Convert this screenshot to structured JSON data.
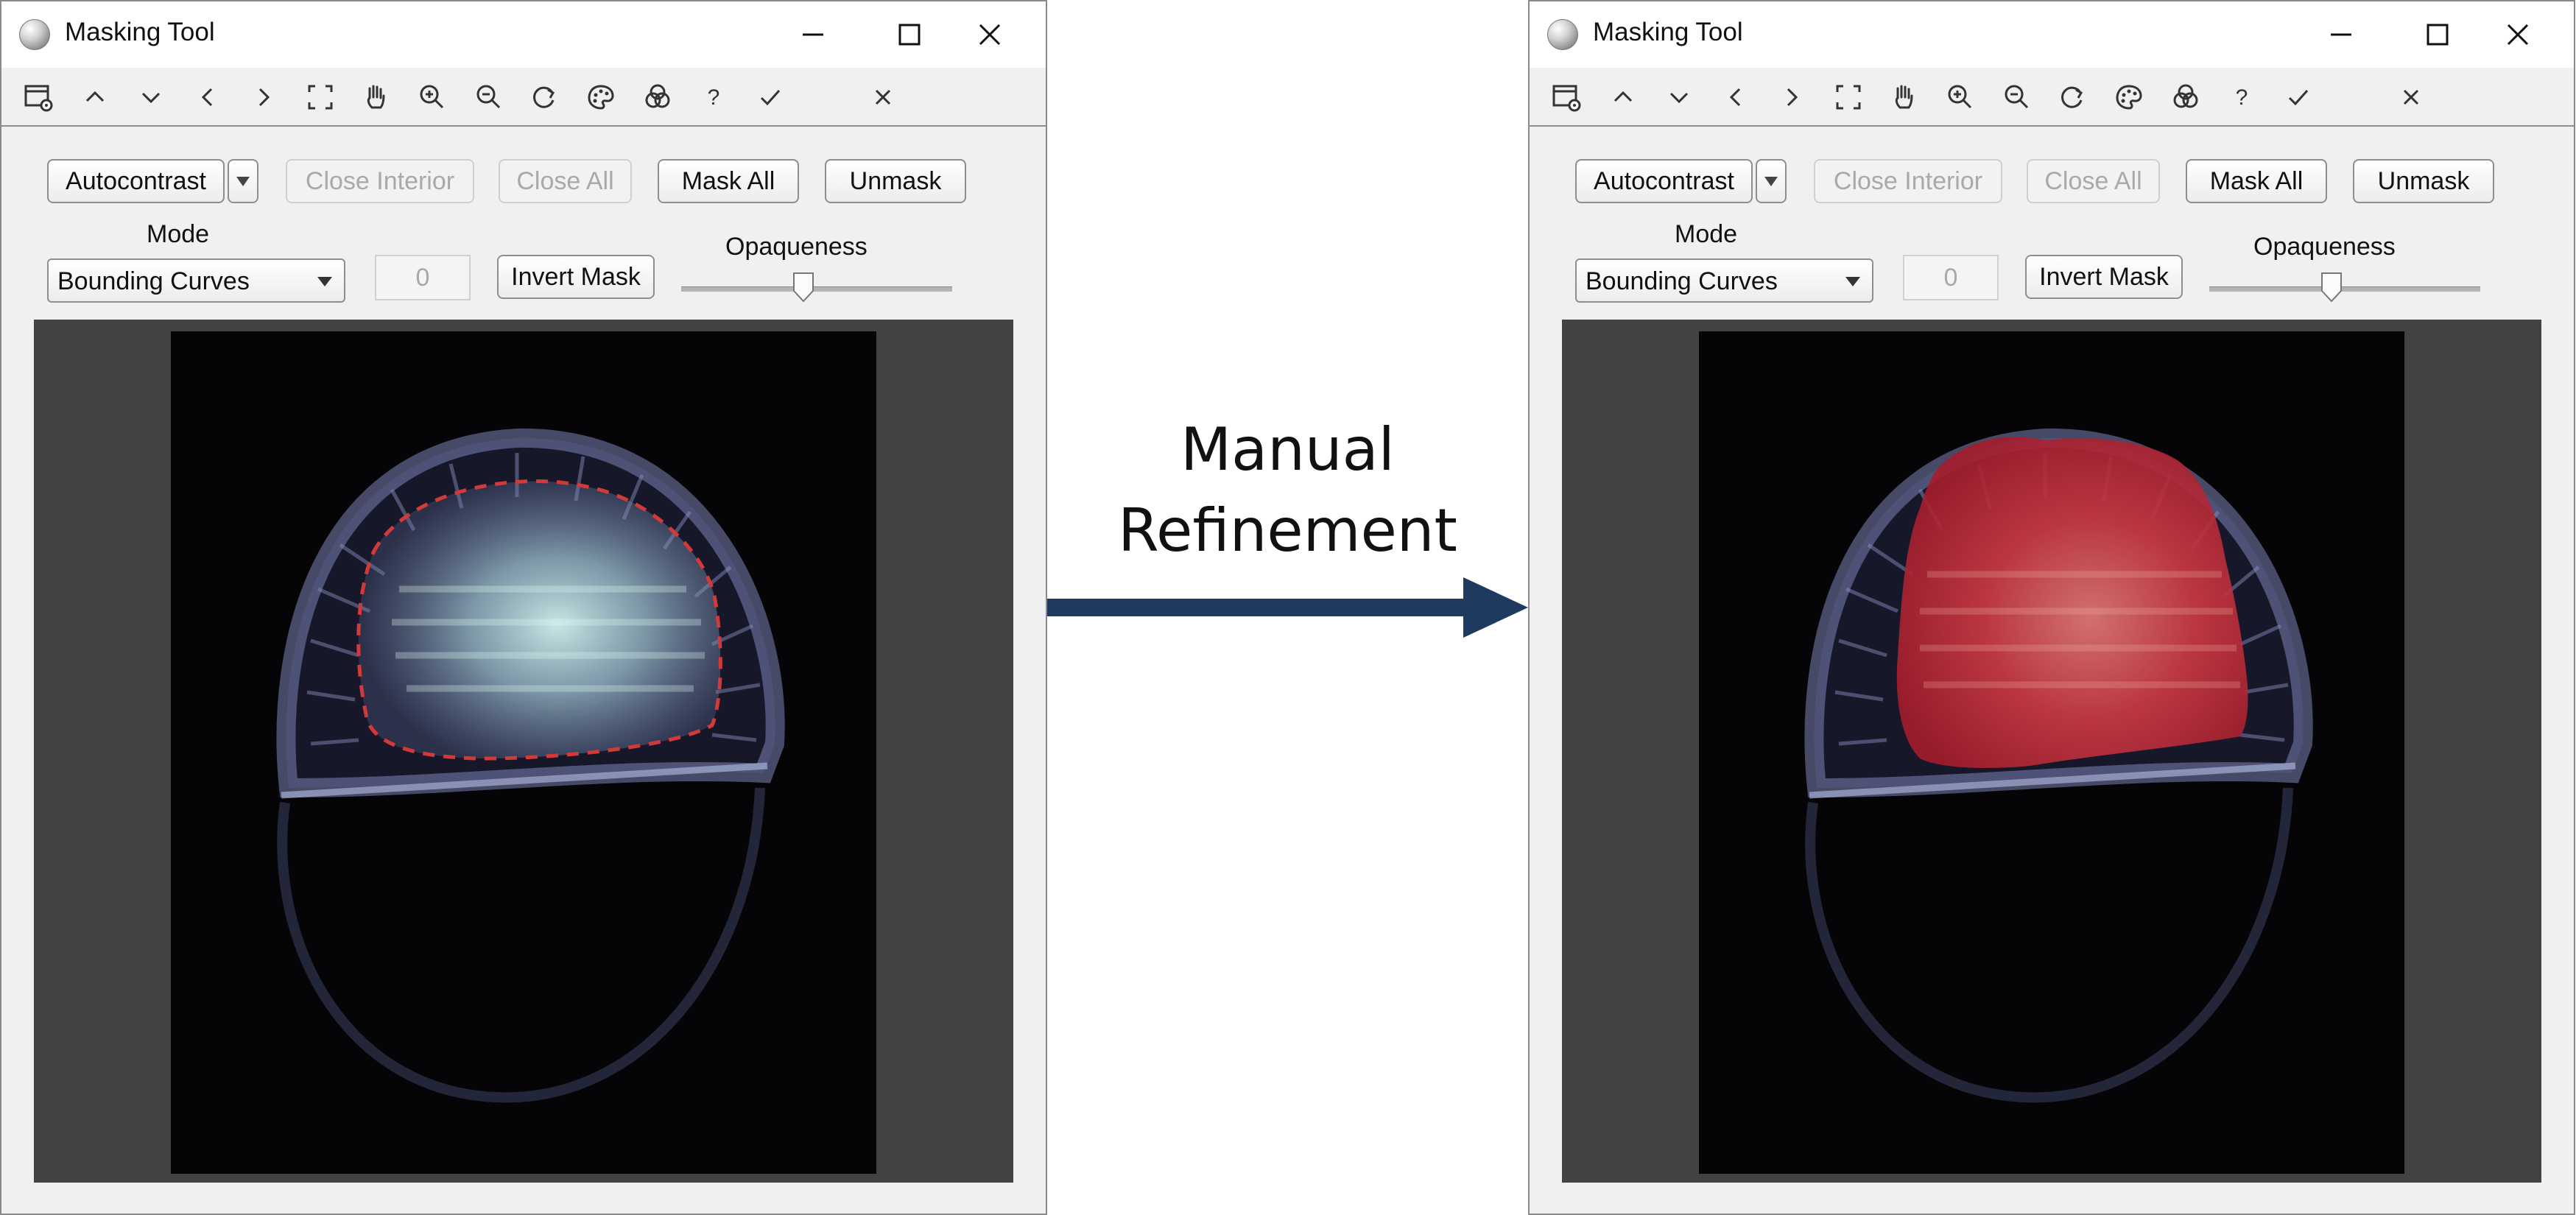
{
  "window_title": "Masking Tool",
  "toolbar_icons": [
    "window-gear-icon",
    "chevron-up-icon",
    "chevron-down-icon",
    "chevron-left-icon",
    "chevron-right-icon",
    "fit-to-window-icon",
    "pan-hand-icon",
    "zoom-in-icon",
    "zoom-out-icon",
    "reset-rotate-icon",
    "colormap-palette-icon",
    "channels-icon",
    "help-icon",
    "accept-check-icon",
    "cancel-close-icon"
  ],
  "toolbar_help_glyph": "?",
  "buttons": {
    "autocontrast": "Autocontrast",
    "close_interior": "Close Interior",
    "close_all": "Close All",
    "mask_all": "Mask All",
    "unmask": "Unmask",
    "invert_mask": "Invert Mask"
  },
  "mode_label": "Mode",
  "mode_value": "Bounding Curves",
  "number_field_value": "0",
  "opaqueness_label": "Opaqueness",
  "opaqueness_level": 0.45,
  "annotation": {
    "line1": "Manual",
    "line2": "Refinement"
  },
  "colors": {
    "arrow": "#1e3a5f",
    "boundary_dashes": "#d23a3a",
    "mask_fill": "#c41e32",
    "window_background": "#f0f0f0",
    "canvas_background": "#424242"
  }
}
